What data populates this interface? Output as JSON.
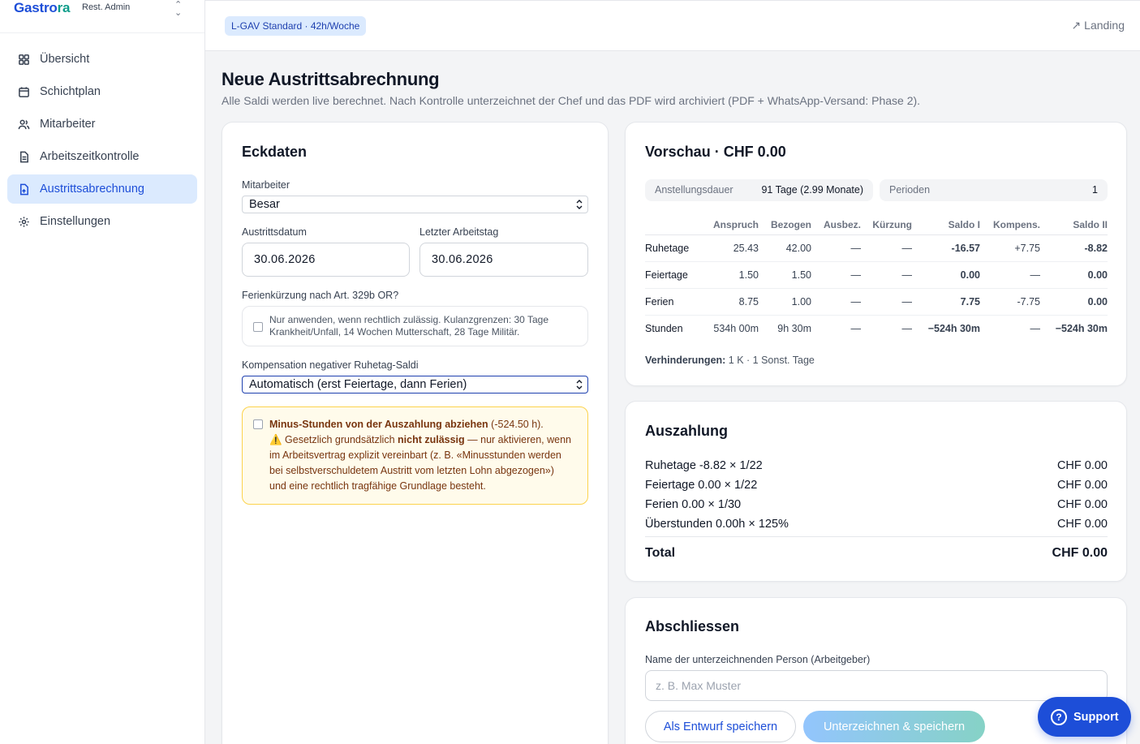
{
  "brand": {
    "name_a": "Gastro",
    "name_b": "ra",
    "subtitle": "Rest. Admin"
  },
  "nav": [
    {
      "label": "Übersicht",
      "icon": "grid-icon"
    },
    {
      "label": "Schichtplan",
      "icon": "calendar-icon"
    },
    {
      "label": "Mitarbeiter",
      "icon": "users-icon"
    },
    {
      "label": "Arbeitszeitkontrolle",
      "icon": "document-icon"
    },
    {
      "label": "Austrittsabrechnung",
      "icon": "exit-document-icon",
      "active": true
    },
    {
      "label": "Einstellungen",
      "icon": "gear-icon"
    }
  ],
  "topbar": {
    "plan_pill": "L-GAV Standard · 42h/Woche",
    "landing_link": "↗ Landing"
  },
  "page": {
    "title": "Neue Austrittsabrechnung",
    "subtitle": "Alle Saldi werden live berechnet. Nach Kontrolle unterzeichnet der Chef und das PDF wird archiviert (PDF + WhatsApp-Versand: Phase 2)."
  },
  "eckdaten": {
    "title": "Eckdaten",
    "mitarbeiter_label": "Mitarbeiter",
    "mitarbeiter_value": "Besar",
    "austritt_label": "Austrittsdatum",
    "austritt_value": "30.06.2026",
    "letzter_label": "Letzter Arbeitstag",
    "letzter_value": "30.06.2026",
    "ferien_label": "Ferienkürzung nach Art. 329b OR?",
    "ferien_info_1": "Nur anwenden, wenn rechtlich zulässig. Kulanzgrenzen: 30 Tage",
    "ferien_info_2": "Krankheit/Unfall, 14 Wochen Mutterschaft, 28 Tage Militär.",
    "komp_label": "Kompensation negativer Ruhetag-Saldi",
    "komp_value": "Automatisch (erst Feiertage, dann Ferien)",
    "warn_bold": "Minus-Stunden von der Auszahlung abziehen",
    "warn_amount": " (-524.50 h).",
    "warn_icon": "⚠️",
    "warn_pre": " Gesetzlich grundsätzlich ",
    "warn_bold2": "nicht zulässig",
    "warn_post": " — nur aktivieren, wenn",
    "warn_line3": "im Arbeitsvertrag explizit vereinbart (z. B. «Minusstunden werden",
    "warn_line4": "bei selbstverschuldetem Austritt vom letzten Lohn abgezogen»)",
    "warn_line5": "und eine rechtlich tragfähige Grundlage besteht."
  },
  "preview": {
    "title": "Vorschau · CHF 0.00",
    "dauer_label": "Anstellungsdauer",
    "dauer_value": "91 Tage (2.99 Monate)",
    "perioden_label": "Perioden",
    "perioden_value": "1",
    "columns": [
      "",
      "Anspruch",
      "Bezogen",
      "Ausbez.",
      "Kürzung",
      "Saldo I",
      "Kompens.",
      "Saldo II"
    ],
    "rows": [
      {
        "name": "Ruhetage",
        "anspruch": "25.43",
        "bezogen": "42.00",
        "ausbez": "—",
        "kuerzung": "—",
        "saldo1": "-16.57",
        "kompens": "+7.75",
        "saldo2": "-8.82"
      },
      {
        "name": "Feiertage",
        "anspruch": "1.50",
        "bezogen": "1.50",
        "ausbez": "—",
        "kuerzung": "—",
        "saldo1": "0.00",
        "kompens": "—",
        "saldo2": "0.00"
      },
      {
        "name": "Ferien",
        "anspruch": "8.75",
        "bezogen": "1.00",
        "ausbez": "—",
        "kuerzung": "—",
        "saldo1": "7.75",
        "kompens": "-7.75",
        "saldo2": "0.00"
      },
      {
        "name": "Stunden",
        "anspruch": "534h 00m",
        "bezogen": "9h 30m",
        "ausbez": "—",
        "kuerzung": "—",
        "saldo1": "−524h 30m",
        "kompens": "—",
        "saldo2": "−524h 30m"
      }
    ],
    "verh_label": "Verhinderungen:",
    "verh_value": " 1 K · 1 Sonst. Tage"
  },
  "auszahlung": {
    "title": "Auszahlung",
    "rows": [
      {
        "label": "Ruhetage -8.82 × 1/22",
        "value": "CHF 0.00"
      },
      {
        "label": "Feiertage 0.00 × 1/22",
        "value": "CHF 0.00"
      },
      {
        "label": "Ferien 0.00 × 1/30",
        "value": "CHF 0.00"
      },
      {
        "label": "Überstunden 0.00h × 125%",
        "value": "CHF 0.00"
      }
    ],
    "total_label": "Total",
    "total_value": "CHF 0.00"
  },
  "abschliessen": {
    "title": "Abschliessen",
    "name_label": "Name der unterzeichnenden Person (Arbeitgeber)",
    "name_placeholder": "z. B. Max Muster",
    "draft_button": "Als Entwurf speichern",
    "sign_button": "Unterzeichnen & speichern"
  },
  "support": {
    "label": "Support",
    "icon_glyph": "?"
  }
}
